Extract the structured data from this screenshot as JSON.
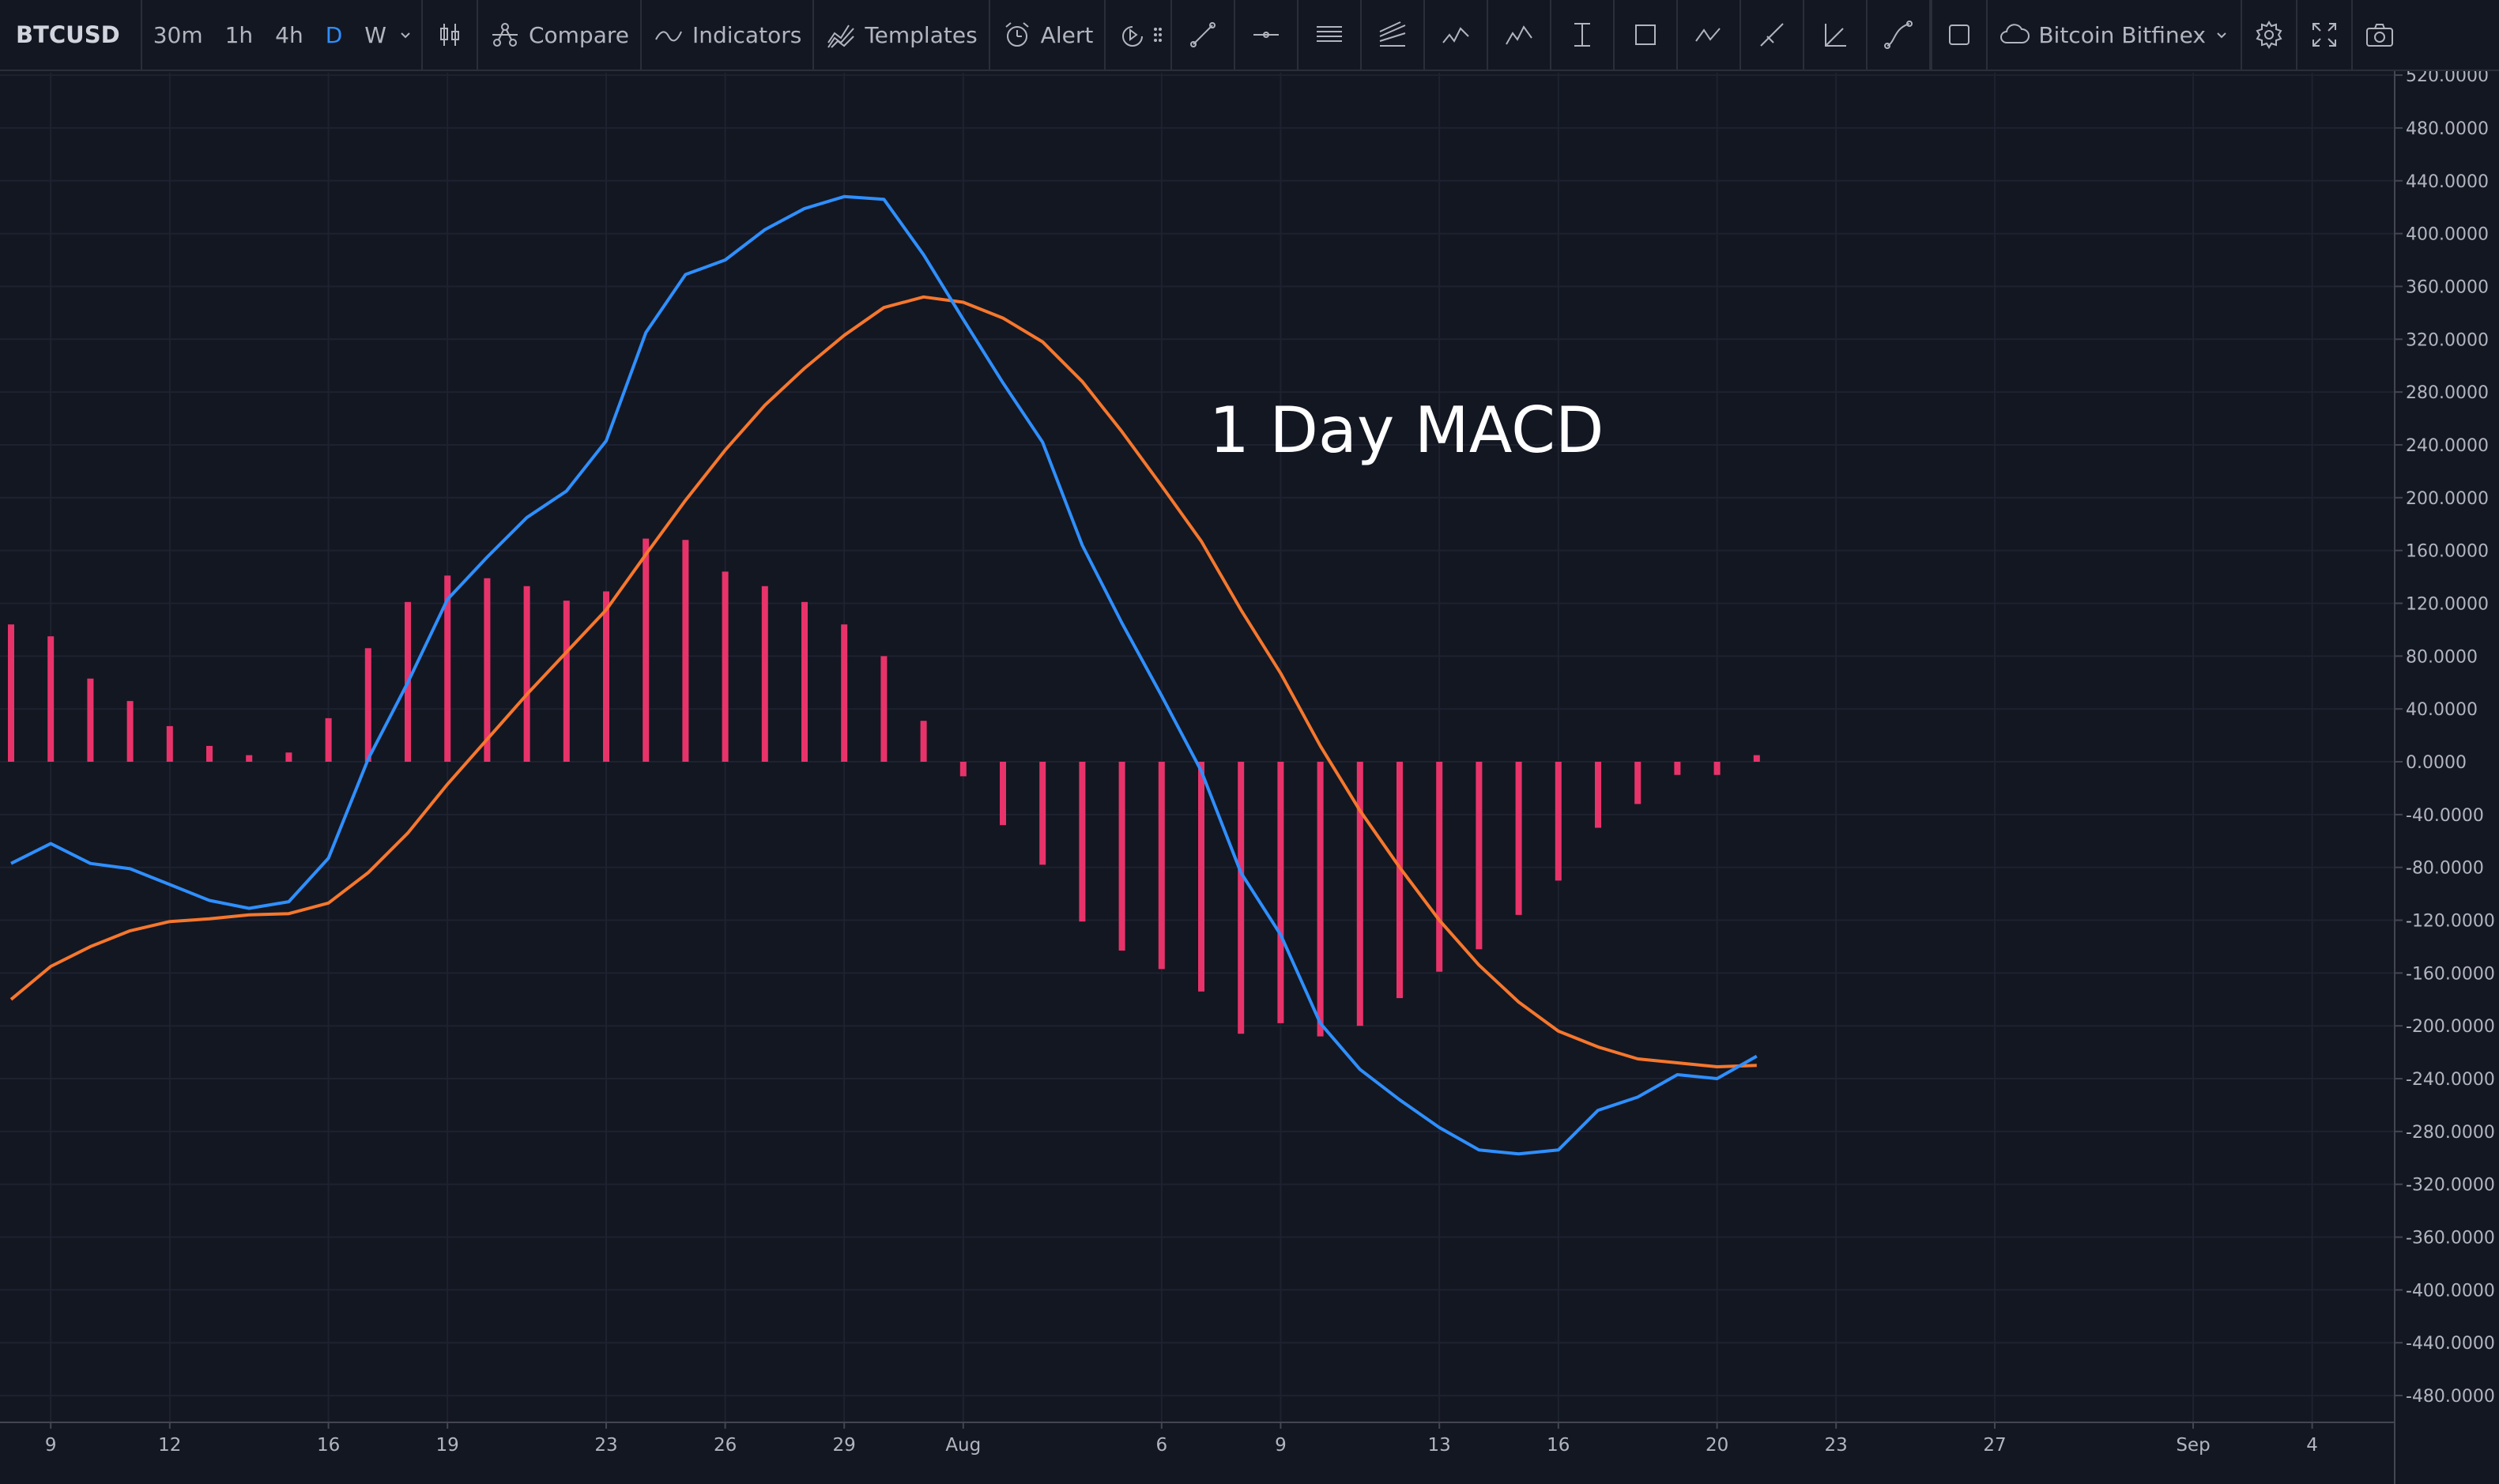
{
  "toolbar": {
    "symbol": "BTCUSD",
    "intervals": [
      "30m",
      "1h",
      "4h",
      "D",
      "W"
    ],
    "active_interval": "D",
    "compare_label": "Compare",
    "indicators_label": "Indicators",
    "templates_label": "Templates",
    "alert_label": "Alert",
    "exchange_label": "Bitcoin Bitfinex",
    "draw_tools": [
      "trend-line-icon",
      "horizontal-line-icon",
      "parallel-channel-icon",
      "pitchfork-icon",
      "xabcd-pattern-icon",
      "elliott-wave-icon",
      "text-tool-icon",
      "rectangle-icon",
      "abcd-pattern-icon",
      "ray-icon",
      "angle-icon",
      "curve-icon"
    ]
  },
  "annotation": "1 Day MACD",
  "colors": {
    "background": "#131722",
    "grid": "#1e2230",
    "macd_line": "#2f8fff",
    "signal_line": "#f6772d",
    "histogram": "#e8336a",
    "axis_text": "#b2b5be",
    "annotation": "#ffffff"
  },
  "chart_data": {
    "type": "line",
    "y_ticks": [
      "520.0000",
      "480.0000",
      "440.0000",
      "400.0000",
      "360.0000",
      "320.0000",
      "280.0000",
      "240.0000",
      "200.0000",
      "160.0000",
      "120.0000",
      "80.0000",
      "40.0000",
      "0.0000",
      "-40.0000",
      "-80.0000",
      "-120.0000",
      "-160.0000",
      "-200.0000",
      "-240.0000",
      "-280.0000",
      "-320.0000",
      "-360.0000",
      "-400.0000",
      "-440.0000",
      "-480.0000"
    ],
    "ylim": [
      -490,
      525
    ],
    "x_ticks": [
      {
        "day": 1,
        "label": "9"
      },
      {
        "day": 4,
        "label": "12"
      },
      {
        "day": 8,
        "label": "16"
      },
      {
        "day": 11,
        "label": "19"
      },
      {
        "day": 15,
        "label": "23"
      },
      {
        "day": 18,
        "label": "26"
      },
      {
        "day": 21,
        "label": "29"
      },
      {
        "day": 24,
        "label": "Aug"
      },
      {
        "day": 29,
        "label": "6"
      },
      {
        "day": 32,
        "label": "9"
      },
      {
        "day": 36,
        "label": "13"
      },
      {
        "day": 39,
        "label": "16"
      },
      {
        "day": 43,
        "label": "20"
      },
      {
        "day": 46,
        "label": "23"
      },
      {
        "day": 50,
        "label": "27"
      },
      {
        "day": 55,
        "label": "Sep"
      },
      {
        "day": 58,
        "label": "4"
      }
    ],
    "xlim": [
      0,
      60
    ],
    "series": [
      {
        "key": "macd",
        "days": [
          0,
          1,
          2,
          3,
          4,
          5,
          6,
          7,
          8,
          9,
          10,
          11,
          12,
          13,
          14,
          15,
          16,
          17,
          18,
          19,
          20,
          21,
          22,
          23,
          24,
          25,
          26,
          27,
          28,
          29,
          30,
          31,
          32,
          33,
          34,
          35,
          36,
          37,
          38,
          39,
          40,
          41,
          42,
          43,
          44
        ],
        "values": [
          -77,
          -62,
          -77,
          -81,
          -93,
          -105,
          -111,
          -106,
          -73,
          2,
          60,
          123,
          155,
          185,
          205,
          243,
          325,
          369,
          380,
          403,
          419,
          428,
          426,
          384,
          335,
          287,
          242,
          164,
          105,
          50,
          -7,
          -84,
          -131,
          -198,
          -233,
          -256,
          -277,
          -294,
          -297,
          -294,
          -264,
          -254,
          -237,
          -240,
          -223
        ]
      },
      {
        "key": "signal",
        "days": [
          0,
          1,
          2,
          3,
          4,
          5,
          6,
          7,
          8,
          9,
          10,
          11,
          12,
          13,
          14,
          15,
          16,
          17,
          18,
          19,
          20,
          21,
          22,
          23,
          24,
          25,
          26,
          27,
          28,
          29,
          30,
          31,
          32,
          33,
          34,
          35,
          36,
          37,
          38,
          39,
          40,
          41,
          42,
          43,
          44
        ],
        "values": [
          -180,
          -155,
          -140,
          -128,
          -121,
          -119,
          -116,
          -115,
          -107,
          -84,
          -54,
          -17,
          17,
          51,
          83,
          115,
          157,
          198,
          236,
          270,
          298,
          323,
          344,
          352,
          348,
          336,
          318,
          288,
          250,
          209,
          167,
          115,
          67,
          12,
          -37,
          -80,
          -120,
          -154,
          -182,
          -204,
          -216,
          -225,
          -228,
          -231,
          -230
        ]
      },
      {
        "key": "histogram",
        "type": "bar",
        "days": [
          0,
          1,
          2,
          3,
          4,
          5,
          6,
          7,
          8,
          9,
          10,
          11,
          12,
          13,
          14,
          15,
          16,
          17,
          18,
          19,
          20,
          21,
          22,
          23,
          24,
          25,
          26,
          27,
          28,
          29,
          30,
          31,
          32,
          33,
          34,
          35,
          36,
          37,
          38,
          39,
          40,
          41,
          42,
          43,
          44
        ],
        "values": [
          104,
          95,
          63,
          46,
          27,
          12,
          5,
          7,
          33,
          86,
          121,
          141,
          139,
          133,
          122,
          129,
          169,
          168,
          144,
          133,
          121,
          104,
          80,
          31,
          -11,
          -48,
          -78,
          -121,
          -143,
          -157,
          -174,
          -206,
          -198,
          -208,
          -200,
          -179,
          -159,
          -142,
          -116,
          -90,
          -50,
          -32,
          -10,
          -10,
          5
        ]
      }
    ]
  }
}
